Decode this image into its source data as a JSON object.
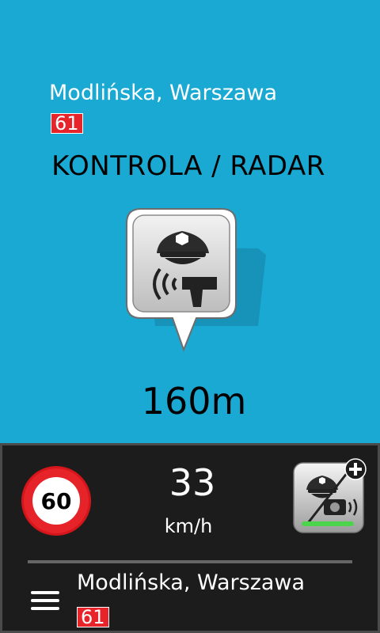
{
  "alert": {
    "street": "Modlińska, Warszawa",
    "road_number": "61",
    "title": "KONTROLA / RADAR",
    "distance": "160m",
    "icon": "police-radar-icon"
  },
  "dashboard": {
    "speed_limit": "60",
    "speed": "33",
    "speed_unit": "km/h",
    "report_icon": "report-police-radar-icon",
    "street": "Modlińska, Warszawa",
    "road_number": "61",
    "menu_icon": "hamburger-menu-icon"
  },
  "colors": {
    "background": "#1aa9d3",
    "panel": "#1d1c1c",
    "road_badge": "#e8242b",
    "speed_limit_ring": "#d4161b",
    "report_bar": "#4cd44c"
  }
}
